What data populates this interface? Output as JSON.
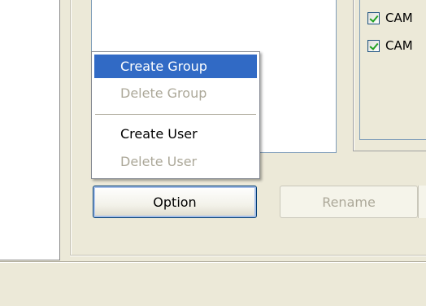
{
  "camera_list": {
    "items": [
      {
        "label": "CAM",
        "checked": true
      },
      {
        "label": "CAM",
        "checked": true
      }
    ]
  },
  "context_menu": {
    "items": [
      {
        "label": "Create Group",
        "state": "highlighted"
      },
      {
        "label": "Delete Group",
        "state": "disabled"
      },
      {
        "label": "Create User",
        "state": "enabled"
      },
      {
        "label": "Delete User",
        "state": "disabled"
      }
    ]
  },
  "buttons": {
    "option_label": "Option",
    "rename_label": "Rename"
  },
  "colors": {
    "highlight": "#316ac5",
    "disabled_text": "#aca899",
    "dialog_bg": "#ece9d8"
  }
}
